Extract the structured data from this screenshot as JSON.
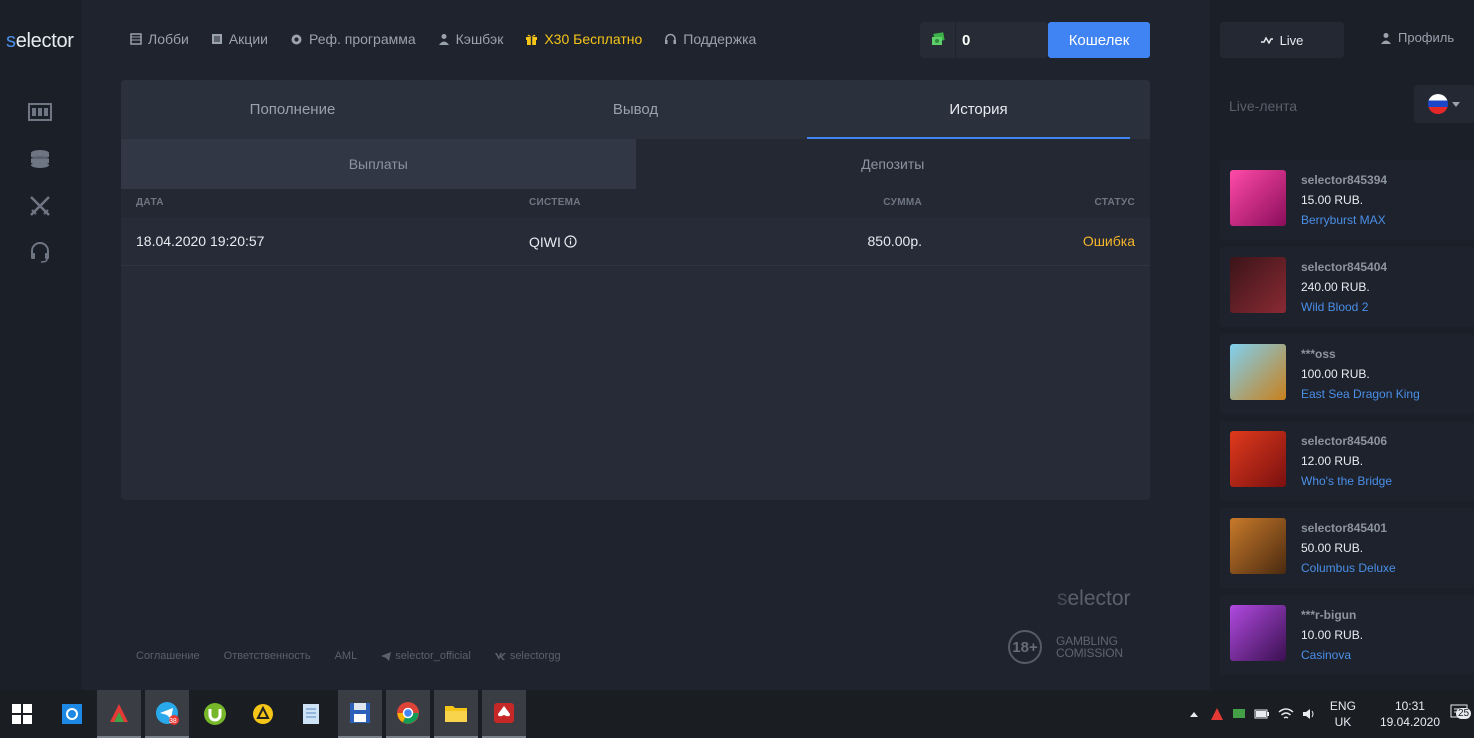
{
  "app": {
    "logo_s": "s",
    "logo_rest": "elector"
  },
  "nav": [
    {
      "label": "Лобби",
      "icon": "lobby-icon"
    },
    {
      "label": "Акции",
      "icon": "promo-icon"
    },
    {
      "label": "Реф. программа",
      "icon": "referral-icon"
    },
    {
      "label": "Кэшбэк",
      "icon": "user-icon"
    },
    {
      "label": "X30 Бесплатно",
      "icon": "gift-icon"
    },
    {
      "label": "Поддержка",
      "icon": "headset-icon"
    }
  ],
  "balance": {
    "value": "0",
    "icon": "money-icon"
  },
  "wallet_label": "Кошелек",
  "tabs": [
    "Пополнение",
    "Вывод",
    "История"
  ],
  "active_tab": "История",
  "subtabs": [
    "Выплаты",
    "Депозиты"
  ],
  "table": {
    "headers": [
      "ДАТА",
      "СИСТЕМА",
      "СУММА",
      "СТАТУС"
    ],
    "rows": [
      {
        "date": "18.04.2020 19:20:57",
        "system": "QIWI",
        "amount": "850.00р.",
        "status": "Ошибка"
      }
    ]
  },
  "footer": {
    "links": [
      "Соглашение",
      "Ответственность",
      "AML",
      "selector_official",
      "selectorgg"
    ],
    "logo_s": "s",
    "logo_rest": "elector",
    "age": "18+",
    "gambling_line1": "GAMBLING",
    "gambling_line2": "COMISSION"
  },
  "right": {
    "live_label": "Live",
    "profile_label": "Профиль",
    "feed_title": "Live-лента",
    "feed": [
      {
        "user": "selector845394",
        "amount": "15.00 RUB.",
        "game": "Berryburst MAX",
        "color": "#c2207a"
      },
      {
        "user": "selector845404",
        "amount": "240.00 RUB.",
        "game": "Wild Blood 2",
        "color": "#6a1f2a"
      },
      {
        "user": "***oss",
        "amount": "100.00 RUB.",
        "game": "East Sea Dragon King",
        "color": "#3f9ec2"
      },
      {
        "user": "selector845406",
        "amount": "12.00 RUB.",
        "game": "Who's the Bridge",
        "color": "#b8281c"
      },
      {
        "user": "selector845401",
        "amount": "50.00 RUB.",
        "game": "Columbus Deluxe",
        "color": "#8a4a1c"
      },
      {
        "user": "***r-bigun",
        "amount": "10.00 RUB.",
        "game": "Casinova",
        "color": "#7a2a9a"
      }
    ]
  },
  "taskbar": {
    "lang1": "ENG",
    "lang2": "UK",
    "time": "10:31",
    "date": "19.04.2020",
    "notif_count": "25",
    "telegram_badge": "38"
  }
}
